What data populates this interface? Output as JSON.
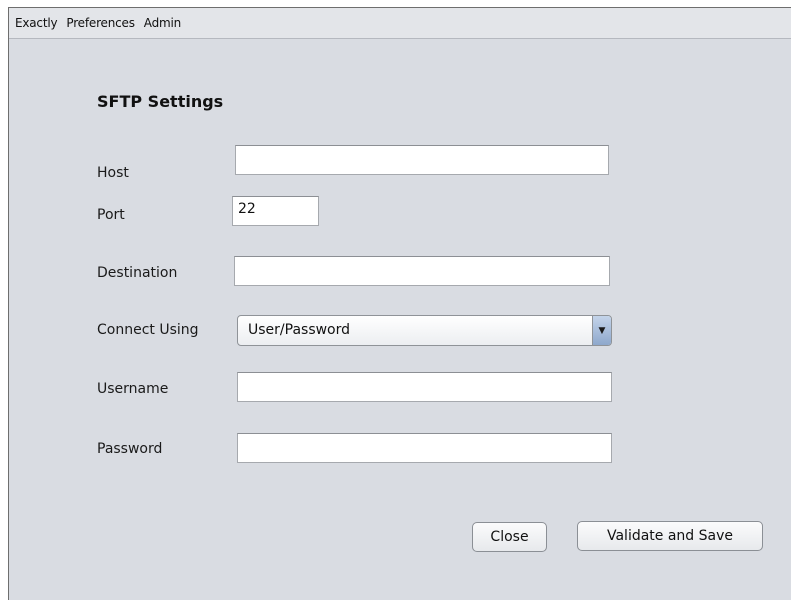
{
  "menubar": {
    "items": [
      "Exactly",
      "Preferences",
      "Admin"
    ]
  },
  "form": {
    "title": "SFTP Settings",
    "host": {
      "label": "Host",
      "value": ""
    },
    "port": {
      "label": "Port",
      "value": "22"
    },
    "destination": {
      "label": "Destination",
      "value": ""
    },
    "connect_using": {
      "label": "Connect Using",
      "selected": "User/Password"
    },
    "username": {
      "label": "Username",
      "value": ""
    },
    "password": {
      "label": "Password",
      "value": ""
    }
  },
  "buttons": {
    "close_label": "Close",
    "validate_save_label": "Validate and Save"
  },
  "icons": {
    "dropdown": "chevron-down-icon"
  }
}
